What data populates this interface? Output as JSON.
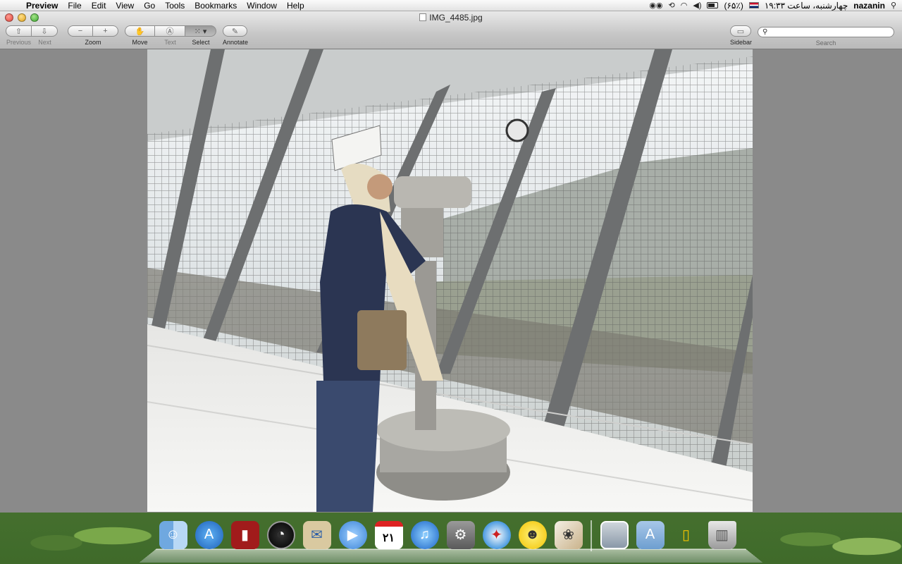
{
  "menubar": {
    "app_name": "Preview",
    "items": [
      "File",
      "Edit",
      "View",
      "Go",
      "Tools",
      "Bookmarks",
      "Window",
      "Help"
    ],
    "status": {
      "battery": "(۶۵٪)",
      "datetime": "چهارشنبه، ساعت ۱۹:۳۳",
      "user": "nazanin"
    }
  },
  "window": {
    "title": "IMG_4485.jpg",
    "toolbar": {
      "previous_label": "Previous",
      "next_label": "Next",
      "zoom_label": "Zoom",
      "move_label": "Move",
      "text_label": "Text",
      "select_label": "Select",
      "annotate_label": "Annotate",
      "sidebar_label": "Sidebar",
      "search_label": "Search",
      "search_value": ""
    }
  },
  "dock": {
    "items": [
      "finder-icon",
      "app-store-icon",
      "photo-booth-icon",
      "dashboard-icon",
      "mail-icon",
      "ichat-icon",
      "ical-icon",
      "itunes-icon",
      "system-preferences-icon",
      "safari-icon",
      "yahoo-messenger-icon",
      "iphoto-icon"
    ],
    "ical_date": "۲۱"
  }
}
